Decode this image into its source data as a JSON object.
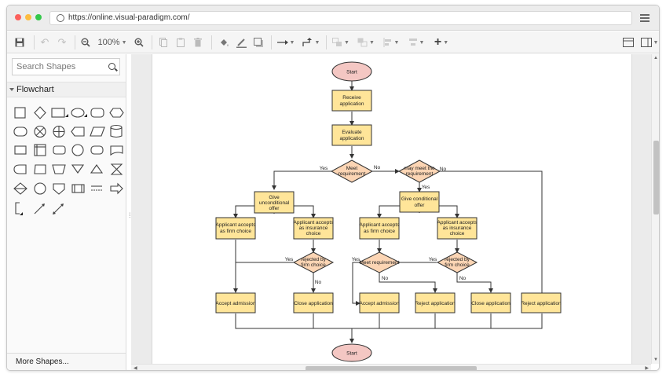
{
  "browser": {
    "url": "https://online.visual-paradigm.com/",
    "dots": [
      "#fc605c",
      "#fdbc40",
      "#34c84a"
    ]
  },
  "toolbar": {
    "zoom": "100%",
    "icons": [
      "save-icon",
      "undo-icon",
      "redo-icon",
      "zoom-out-icon",
      "zoom-in-icon",
      "copy-icon",
      "paste-icon",
      "delete-icon",
      "fill-color-icon",
      "line-color-icon",
      "shadow-icon",
      "connector-icon",
      "waypoint-icon",
      "to-front-icon",
      "to-back-icon",
      "align-icon",
      "distribute-icon",
      "insert-icon",
      "format-panel-icon",
      "outline-icon"
    ]
  },
  "sidebar": {
    "search_placeholder": "Search Shapes",
    "category": "Flowchart",
    "more_shapes": "More Shapes..."
  },
  "colors": {
    "process_fill": "#ffe599",
    "decision_fill": "#fcd5b4",
    "terminal_fill": "#f4c7c3",
    "stroke": "#333333"
  },
  "flowchart": {
    "start_top": "Start",
    "receive": "Receive application",
    "evaluate": "Evaluate application",
    "meet_req": "Meet requirement",
    "may_meet": "may meet the requirement",
    "give_uncond": "Give unconditional offer",
    "give_cond": "Give conditional offer",
    "firm_choice_1": "Applicant accepts as firm choice",
    "insurance_choice": "Applicant accepts as insurance choice",
    "firm_choice_2": "Applicant accepts as firm choice",
    "insurance_choice_2": "Applicant accepts as insurance choice",
    "rejected_1": "rejected by firm choice",
    "meet_req_2": "Meet requirement",
    "rejected_2": "rejected by firm choice",
    "accept_admission_1": "Accept admission",
    "close_application_1": "Close application",
    "accept_admission_2": "Accept admission",
    "reject_application_1": "Reject application",
    "close_application_2": "Close application",
    "reject_application_2": "Reject application",
    "start_bottom": "Start",
    "yes": "Yes",
    "no": "No"
  }
}
